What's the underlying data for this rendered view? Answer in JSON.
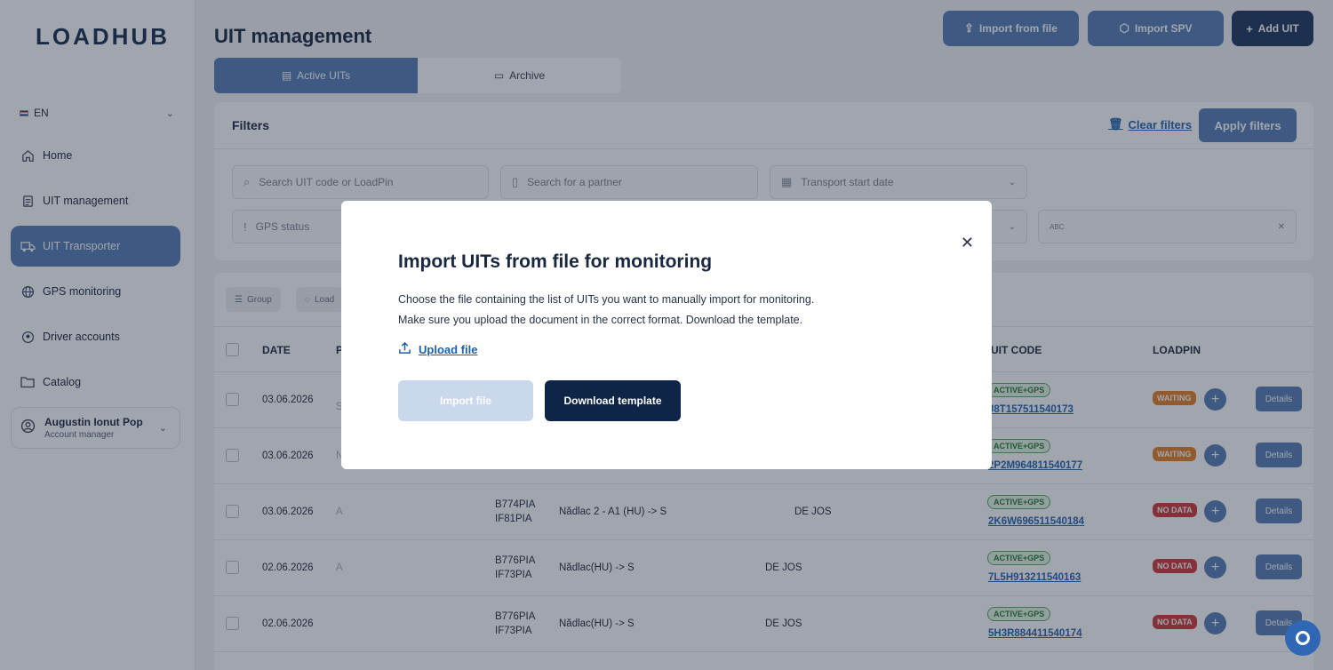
{
  "app": {
    "logo": "LOADHUB",
    "page_title": "UIT management"
  },
  "sidebar": {
    "language": "EN",
    "items": [
      {
        "label": "Home",
        "icon": "home-icon"
      },
      {
        "label": "UIT management",
        "icon": "document-icon"
      },
      {
        "label": "UIT Transporter",
        "icon": "truck-icon",
        "active": true
      },
      {
        "label": "GPS monitoring",
        "icon": "globe-icon"
      },
      {
        "label": "Driver accounts",
        "icon": "user-circle-icon"
      },
      {
        "label": "Catalog",
        "icon": "folder-icon"
      }
    ],
    "user": {
      "name": "Augustin Ionut Pop",
      "role": "Account manager"
    }
  },
  "header": {
    "import_file_label": "Import from file",
    "import_spv_label": "Import SPV",
    "add_uit_label": "Add UIT"
  },
  "tabs": {
    "active_label": "Active UITs",
    "archive_label": "Archive"
  },
  "filters": {
    "title": "Filters",
    "clear_label": "Clear filters",
    "apply_label": "Apply filters",
    "search_uit_placeholder": "Search UIT code or LoadPin",
    "search_partner_placeholder": "Search for a partner",
    "transport_date_placeholder": "Transport start date",
    "gps_status_placeholder": "GPS status",
    "tag_placeholder": "ABC"
  },
  "toolbar": {
    "group_label": "Group",
    "load_label": "Load"
  },
  "table": {
    "headers": {
      "date": "DATE",
      "partner_initial": "P",
      "uit_code": "UIT CODE",
      "loadpin": "LOADPIN"
    },
    "details_label": "Details",
    "rows": [
      {
        "date": "03.06.2026",
        "partner": "S",
        "truck": "",
        "trailer": "",
        "route": "",
        "route_tail": "",
        "gps": "ACTIVE+GPS",
        "uit": "J8T157511540173",
        "status": "WAITING"
      },
      {
        "date": "03.06.2026",
        "partner": "N",
        "truck": "",
        "trailer": "",
        "route": "",
        "route_tail": "",
        "gps": "ACTIVE+GPS",
        "uit": "2P2M964811540177",
        "status": "WAITING"
      },
      {
        "date": "03.06.2026",
        "partner": "A",
        "truck": "B774PIA",
        "trailer": "IF81PIA",
        "route": "Nădlac 2 - A1 (HU) -> S",
        "route_tail": "DE JOS",
        "gps": "ACTIVE+GPS",
        "uit": "2K6W696511540184",
        "status": "NO DATA"
      },
      {
        "date": "02.06.2026",
        "partner": "A",
        "truck": "B776PIA",
        "trailer": "IF73PIA",
        "route": "Nădlac(HU) -> S",
        "route_tail": "DE JOS",
        "gps": "ACTIVE+GPS",
        "uit": "7L5H913211540163",
        "status": "NO DATA"
      },
      {
        "date": "02.06.2026",
        "partner": "",
        "truck": "B776PIA",
        "trailer": "IF73PIA",
        "route": "Nădlac(HU) -> S",
        "route_tail": "DE JOS",
        "gps": "ACTIVE+GPS",
        "uit": "5H3R884411540174",
        "status": "NO DATA"
      }
    ]
  },
  "modal": {
    "title": "Import UITs from file for monitoring",
    "line1": "Choose the file containing the list of UITs you want to manually import for monitoring.",
    "line2": "Make sure you upload the document in the correct format. Download the template.",
    "upload_label": "Upload file",
    "import_label": "Import file",
    "download_label": "Download template"
  },
  "colors": {
    "accent": "#5d83b8",
    "dark_navy": "#0f2547",
    "link": "#2a6bb5",
    "waiting": "#e5842b",
    "no_data": "#d23f3f",
    "gps_green": "#57b35d"
  }
}
